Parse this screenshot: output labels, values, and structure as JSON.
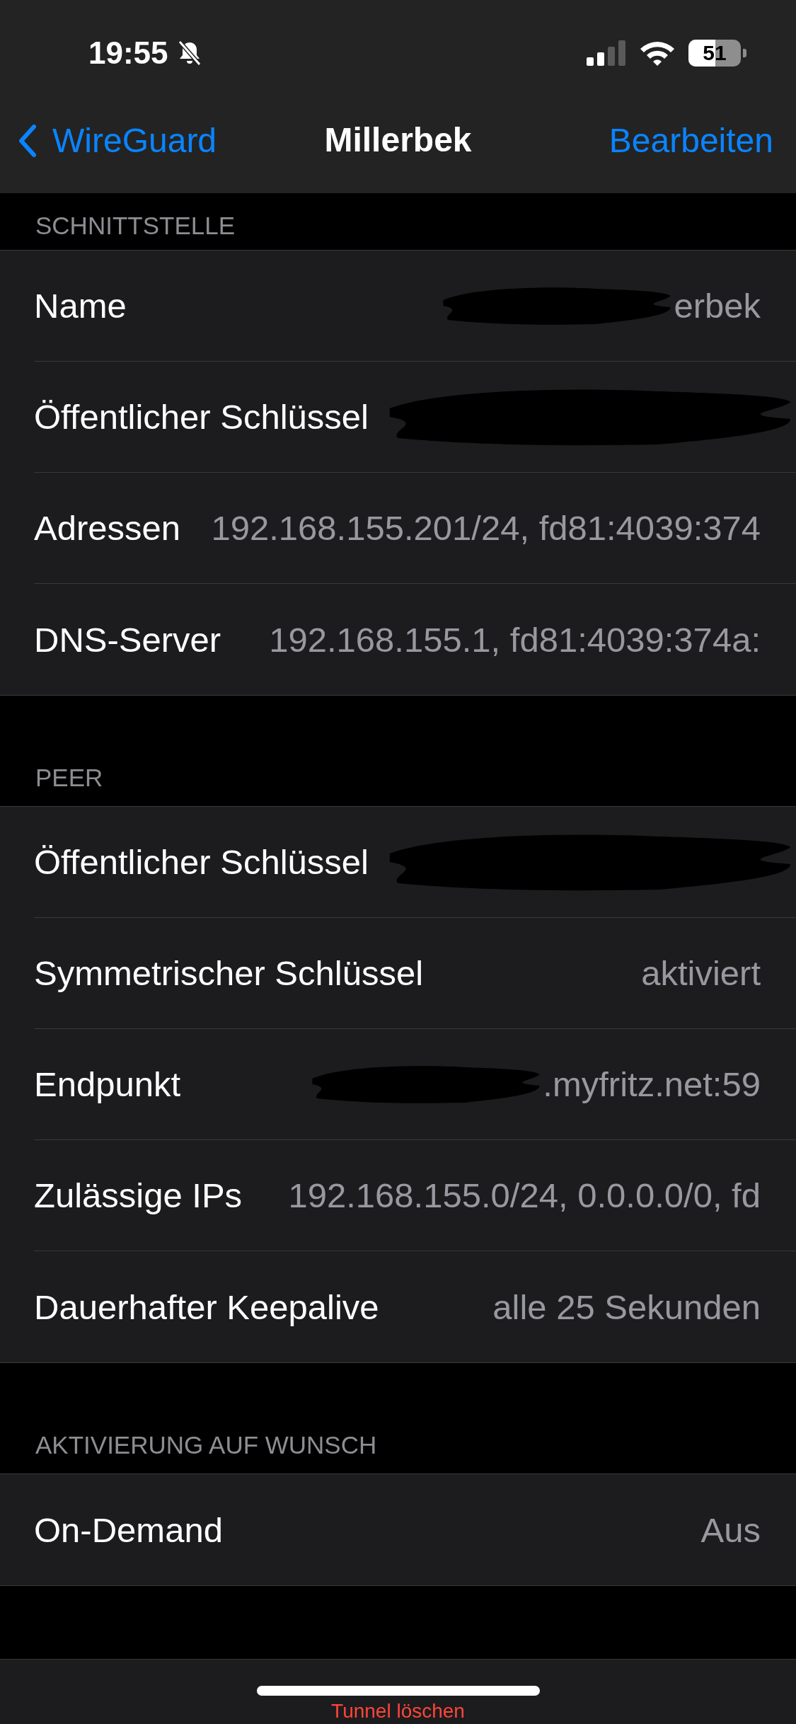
{
  "status_bar": {
    "time": "19:55",
    "silent": true,
    "battery": "51"
  },
  "nav_bar": {
    "back": "WireGuard",
    "title": "Millerbek",
    "action": "Bearbeiten"
  },
  "sections": [
    {
      "header": "SCHNITTSTELLE",
      "rows": [
        {
          "label": "Name",
          "value": "erbek",
          "redacted": true
        },
        {
          "label": "Öffentlicher Schlüssel",
          "redacted": true
        },
        {
          "label": "Adressen",
          "value": "192.168.155.201/24, fd81:4039:374",
          "redacted": false
        },
        {
          "label": "DNS-Server",
          "value": "192.168.155.1, fd81:4039:374a:",
          "redacted": false
        }
      ]
    },
    {
      "header": "PEER",
      "rows": [
        {
          "label": "Öffentlicher Schlüssel",
          "redacted": true
        },
        {
          "label": "Symmetrischer Schlüssel",
          "value": "aktiviert",
          "redacted": false
        },
        {
          "label": "Endpunkt",
          "value": ".myfritz.net:59",
          "redacted": true
        },
        {
          "label": "Zulässige IPs",
          "value": "192.168.155.0/24, 0.0.0.0/0, fd",
          "redacted": false
        },
        {
          "label": "Dauerhafter Keepalive",
          "value": "alle 25 Sekunden",
          "redacted": false
        }
      ]
    },
    {
      "header": "AKTIVIERUNG AUF WUNSCH",
      "rows": [
        {
          "label": "On-Demand",
          "value": "Aus",
          "redacted": false
        }
      ]
    }
  ],
  "delete_button": "Tunnel löschen"
}
